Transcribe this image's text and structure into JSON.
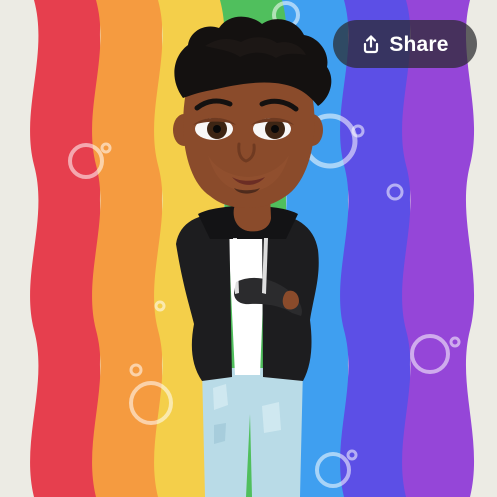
{
  "toolbar": {
    "share_label": "Share",
    "share_icon": "share-upload-icon"
  },
  "scene": {
    "stripe_colors": [
      "#e63f4e",
      "#f59b40",
      "#f4cf4a",
      "#50bf5d",
      "#3f9ff0",
      "#5c4fe6",
      "#9546d8"
    ],
    "background_color": "#ecebe4"
  }
}
